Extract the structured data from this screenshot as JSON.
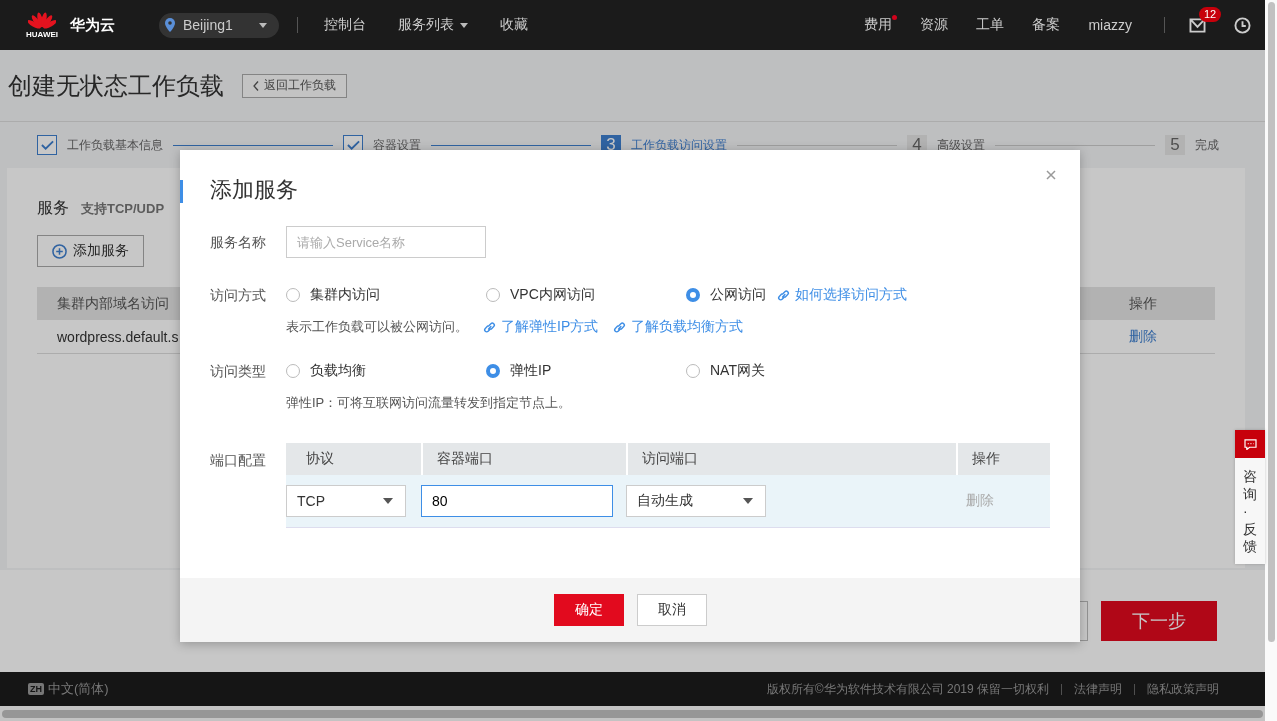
{
  "topbar": {
    "logo_text": "HUAWEI",
    "brand": "华为云",
    "region": "Beijing1",
    "nav": [
      {
        "label": "控制台",
        "dropdown": false
      },
      {
        "label": "服务列表",
        "dropdown": true
      },
      {
        "label": "收藏",
        "dropdown": false
      }
    ],
    "right_nav": [
      {
        "label": "费用",
        "dot": true
      },
      {
        "label": "资源",
        "dot": false
      },
      {
        "label": "工单",
        "dot": false
      },
      {
        "label": "备案",
        "dot": false
      }
    ],
    "user": "miazzy",
    "mail_badge": "12"
  },
  "page": {
    "title": "创建无状态工作负载",
    "back_button": "返回工作负载",
    "steps": [
      {
        "label": "工作负载基本信息",
        "checked": true,
        "selected": false
      },
      {
        "label": "容器设置",
        "checked": true,
        "selected": false
      },
      {
        "number": "3",
        "label": "工作负载访问设置",
        "checked": false,
        "selected": true
      },
      {
        "number": "4",
        "label": "高级设置",
        "checked": false,
        "selected": false
      },
      {
        "number": "5",
        "label": "完成",
        "checked": false,
        "selected": false
      }
    ],
    "service_section": {
      "title": "服务",
      "hint": "支持TCP/UDP",
      "add_button": "添加服务",
      "table": {
        "columns": [
          "集群内部域名访问",
          "操作"
        ],
        "rows": [
          [
            "wordpress.default.s",
            "删除"
          ]
        ]
      }
    },
    "next_button": "下一步"
  },
  "dialog": {
    "title": "添加服务",
    "name_field": {
      "label": "服务名称",
      "placeholder": "请输入Service名称"
    },
    "access_mode": {
      "label": "访问方式",
      "options": [
        {
          "label": "集群内访问",
          "selected": false
        },
        {
          "label": "VPC内网访问",
          "selected": false
        },
        {
          "label": "公网访问",
          "selected": true
        }
      ],
      "help_link": "如何选择访问方式",
      "description": "表示工作负载可以被公网访问。",
      "links": [
        "了解弹性IP方式",
        "了解负载均衡方式"
      ]
    },
    "access_type": {
      "label": "访问类型",
      "options": [
        {
          "label": "负载均衡",
          "selected": false
        },
        {
          "label": "弹性IP",
          "selected": true
        },
        {
          "label": "NAT网关",
          "selected": false
        }
      ],
      "description": "弹性IP：可将互联网访问流量转发到指定节点上。"
    },
    "ports": {
      "label": "端口配置",
      "columns": [
        "协议",
        "容器端口",
        "访问端口",
        "操作"
      ],
      "rows": [
        {
          "protocol": "TCP",
          "container_port": "80",
          "access_port": "自动生成",
          "action": "删除",
          "disabled": true
        }
      ]
    },
    "buttons": [
      {
        "label": "确定",
        "kind": "primary"
      },
      {
        "label": "取消",
        "kind": "secondary"
      }
    ]
  },
  "feedback_tab": {
    "label": "咨询·反馈"
  },
  "footer": {
    "language_badge": "ZH",
    "language": "中文(简体)",
    "links": [
      "版权所有©华为软件技术有限公司 2019 保留一切权利",
      "法律声明",
      "隐私政策声明"
    ]
  }
}
